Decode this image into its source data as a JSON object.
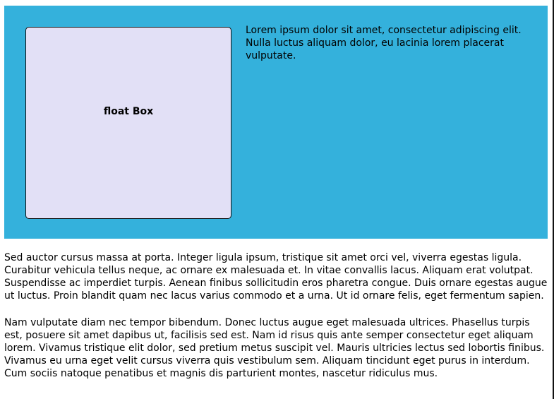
{
  "wrapper": {
    "background_color": "#34b1dc",
    "float_box": {
      "label": "float Box",
      "background_color": "#e2e0f6"
    },
    "text": "Lorem ipsum dolor sit amet, consectetur adipiscing elit. Nulla luctus aliquam dolor, eu lacinia lorem placerat vulputate."
  },
  "paragraphs": [
    "Sed auctor cursus massa at porta. Integer ligula ipsum, tristique sit amet orci vel, viverra egestas ligula. Curabitur vehicula tellus neque, ac ornare ex malesuada et. In vitae convallis lacus. Aliquam erat volutpat. Suspendisse ac imperdiet turpis. Aenean finibus sollicitudin eros pharetra congue. Duis ornare egestas augue ut luctus. Proin blandit quam nec lacus varius commodo et a urna. Ut id ornare felis, eget fermentum sapien.",
    "Nam vulputate diam nec tempor bibendum. Donec luctus augue eget malesuada ultrices. Phasellus turpis est, posuere sit amet dapibus ut, facilisis sed est. Nam id risus quis ante semper consectetur eget aliquam lorem. Vivamus tristique elit dolor, sed pretium metus suscipit vel. Mauris ultricies lectus sed lobortis finibus. Vivamus eu urna eget velit cursus viverra quis vestibulum sem. Aliquam tincidunt eget purus in interdum. Cum sociis natoque penatibus et magnis dis parturient montes, nascetur ridiculus mus."
  ]
}
